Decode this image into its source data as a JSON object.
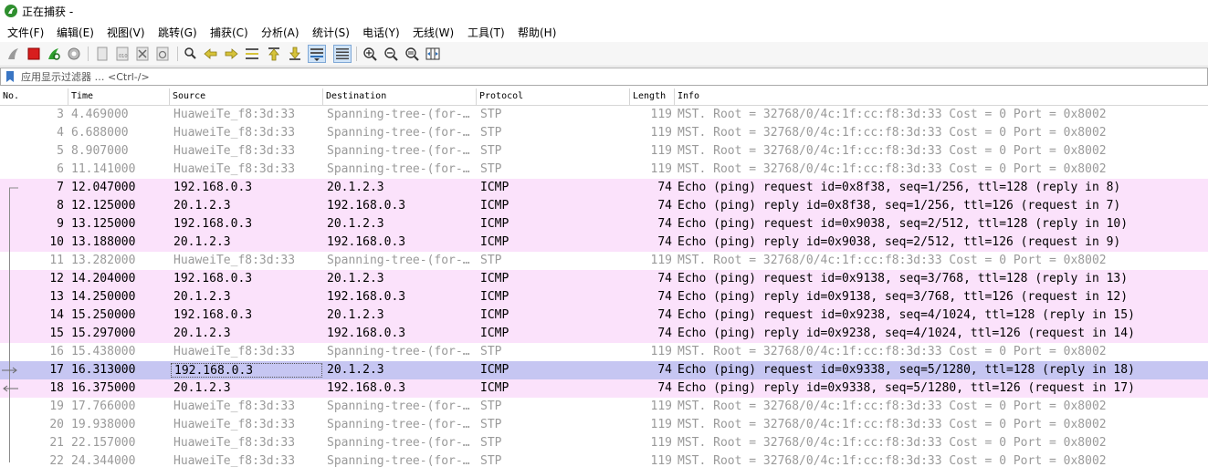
{
  "window": {
    "title": "正在捕获 -"
  },
  "menu": [
    "文件(F)",
    "编辑(E)",
    "视图(V)",
    "跳转(G)",
    "捕获(C)",
    "分析(A)",
    "统计(S)",
    "电话(Y)",
    "无线(W)",
    "工具(T)",
    "帮助(H)"
  ],
  "filter": {
    "placeholder": "应用显示过滤器 … <Ctrl-/>"
  },
  "columns": [
    "No.",
    "Time",
    "Source",
    "Destination",
    "Protocol",
    "Length",
    "Info"
  ],
  "colors": {
    "icmp_row": "#fbe2fb",
    "selected_row": "#c6c6f2",
    "stp_text": "#9a9a9a"
  },
  "packets": [
    {
      "no": "3",
      "time": "4.469000",
      "src": "HuaweiTe_f8:3d:33",
      "dst": "Spanning-tree-(for-…",
      "proto": "STP",
      "len": "119",
      "info": "MST. Root = 32768/0/4c:1f:cc:f8:3d:33  Cost = 0  Port = 0x8002",
      "kind": "stp"
    },
    {
      "no": "4",
      "time": "6.688000",
      "src": "HuaweiTe_f8:3d:33",
      "dst": "Spanning-tree-(for-…",
      "proto": "STP",
      "len": "119",
      "info": "MST. Root = 32768/0/4c:1f:cc:f8:3d:33  Cost = 0  Port = 0x8002",
      "kind": "stp"
    },
    {
      "no": "5",
      "time": "8.907000",
      "src": "HuaweiTe_f8:3d:33",
      "dst": "Spanning-tree-(for-…",
      "proto": "STP",
      "len": "119",
      "info": "MST. Root = 32768/0/4c:1f:cc:f8:3d:33  Cost = 0  Port = 0x8002",
      "kind": "stp"
    },
    {
      "no": "6",
      "time": "11.141000",
      "src": "HuaweiTe_f8:3d:33",
      "dst": "Spanning-tree-(for-…",
      "proto": "STP",
      "len": "119",
      "info": "MST. Root = 32768/0/4c:1f:cc:f8:3d:33  Cost = 0  Port = 0x8002",
      "kind": "stp"
    },
    {
      "no": "7",
      "time": "12.047000",
      "src": "192.168.0.3",
      "dst": "20.1.2.3",
      "proto": "ICMP",
      "len": "74",
      "info": "Echo (ping) request  id=0x8f38, seq=1/256, ttl=128 (reply in 8)",
      "kind": "icmp"
    },
    {
      "no": "8",
      "time": "12.125000",
      "src": "20.1.2.3",
      "dst": "192.168.0.3",
      "proto": "ICMP",
      "len": "74",
      "info": "Echo (ping) reply    id=0x8f38, seq=1/256, ttl=126 (request in 7)",
      "kind": "icmp"
    },
    {
      "no": "9",
      "time": "13.125000",
      "src": "192.168.0.3",
      "dst": "20.1.2.3",
      "proto": "ICMP",
      "len": "74",
      "info": "Echo (ping) request  id=0x9038, seq=2/512, ttl=128 (reply in 10)",
      "kind": "icmp"
    },
    {
      "no": "10",
      "time": "13.188000",
      "src": "20.1.2.3",
      "dst": "192.168.0.3",
      "proto": "ICMP",
      "len": "74",
      "info": "Echo (ping) reply    id=0x9038, seq=2/512, ttl=126 (request in 9)",
      "kind": "icmp"
    },
    {
      "no": "11",
      "time": "13.282000",
      "src": "HuaweiTe_f8:3d:33",
      "dst": "Spanning-tree-(for-…",
      "proto": "STP",
      "len": "119",
      "info": "MST. Root = 32768/0/4c:1f:cc:f8:3d:33  Cost = 0  Port = 0x8002",
      "kind": "stp"
    },
    {
      "no": "12",
      "time": "14.204000",
      "src": "192.168.0.3",
      "dst": "20.1.2.3",
      "proto": "ICMP",
      "len": "74",
      "info": "Echo (ping) request  id=0x9138, seq=3/768, ttl=128 (reply in 13)",
      "kind": "icmp"
    },
    {
      "no": "13",
      "time": "14.250000",
      "src": "20.1.2.3",
      "dst": "192.168.0.3",
      "proto": "ICMP",
      "len": "74",
      "info": "Echo (ping) reply    id=0x9138, seq=3/768, ttl=126 (request in 12)",
      "kind": "icmp"
    },
    {
      "no": "14",
      "time": "15.250000",
      "src": "192.168.0.3",
      "dst": "20.1.2.3",
      "proto": "ICMP",
      "len": "74",
      "info": "Echo (ping) request  id=0x9238, seq=4/1024, ttl=128 (reply in 15)",
      "kind": "icmp"
    },
    {
      "no": "15",
      "time": "15.297000",
      "src": "20.1.2.3",
      "dst": "192.168.0.3",
      "proto": "ICMP",
      "len": "74",
      "info": "Echo (ping) reply    id=0x9238, seq=4/1024, ttl=126 (request in 14)",
      "kind": "icmp"
    },
    {
      "no": "16",
      "time": "15.438000",
      "src": "HuaweiTe_f8:3d:33",
      "dst": "Spanning-tree-(for-…",
      "proto": "STP",
      "len": "119",
      "info": "MST. Root = 32768/0/4c:1f:cc:f8:3d:33  Cost = 0  Port = 0x8002",
      "kind": "stp"
    },
    {
      "no": "17",
      "time": "16.313000",
      "src": "192.168.0.3",
      "dst": "20.1.2.3",
      "proto": "ICMP",
      "len": "74",
      "info": "Echo (ping) request  id=0x9338, seq=5/1280, ttl=128 (reply in 18)",
      "kind": "selected"
    },
    {
      "no": "18",
      "time": "16.375000",
      "src": "20.1.2.3",
      "dst": "192.168.0.3",
      "proto": "ICMP",
      "len": "74",
      "info": "Echo (ping) reply    id=0x9338, seq=5/1280, ttl=126 (request in 17)",
      "kind": "icmp"
    },
    {
      "no": "19",
      "time": "17.766000",
      "src": "HuaweiTe_f8:3d:33",
      "dst": "Spanning-tree-(for-…",
      "proto": "STP",
      "len": "119",
      "info": "MST. Root = 32768/0/4c:1f:cc:f8:3d:33  Cost = 0  Port = 0x8002",
      "kind": "stp"
    },
    {
      "no": "20",
      "time": "19.938000",
      "src": "HuaweiTe_f8:3d:33",
      "dst": "Spanning-tree-(for-…",
      "proto": "STP",
      "len": "119",
      "info": "MST. Root = 32768/0/4c:1f:cc:f8:3d:33  Cost = 0  Port = 0x8002",
      "kind": "stp"
    },
    {
      "no": "21",
      "time": "22.157000",
      "src": "HuaweiTe_f8:3d:33",
      "dst": "Spanning-tree-(for-…",
      "proto": "STP",
      "len": "119",
      "info": "MST. Root = 32768/0/4c:1f:cc:f8:3d:33  Cost = 0  Port = 0x8002",
      "kind": "stp"
    },
    {
      "no": "22",
      "time": "24.344000",
      "src": "HuaweiTe_f8:3d:33",
      "dst": "Spanning-tree-(for-…",
      "proto": "STP",
      "len": "119",
      "info": "MST. Root = 32768/0/4c:1f:cc:f8:3d:33  Cost = 0  Port = 0x8002",
      "kind": "stp"
    }
  ]
}
